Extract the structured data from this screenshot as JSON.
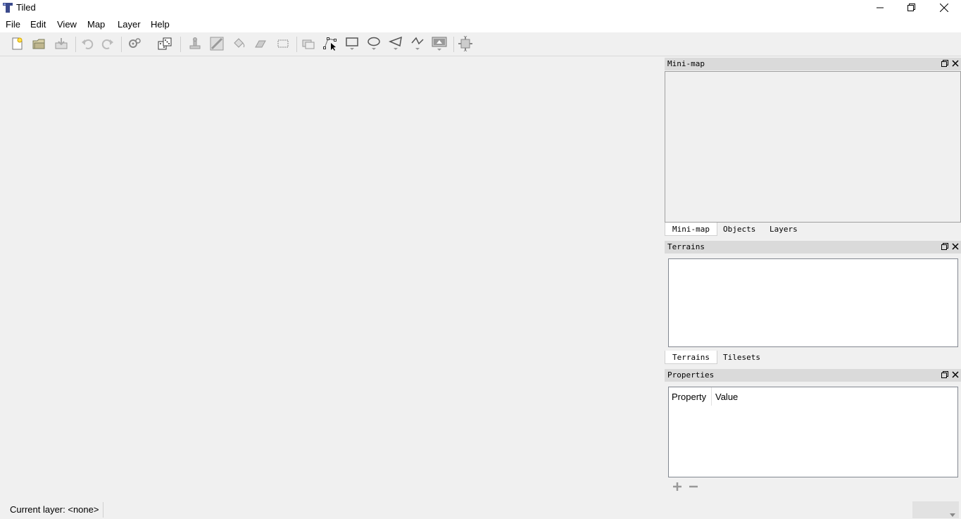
{
  "window": {
    "title": "Tiled"
  },
  "menu": [
    {
      "label": "File"
    },
    {
      "label": "Edit"
    },
    {
      "label": "View"
    },
    {
      "label": "Map"
    },
    {
      "label": "Layer"
    },
    {
      "label": "Help"
    }
  ],
  "minimap_dock": {
    "title": "Mini-map"
  },
  "top_tabs": [
    {
      "label": "Mini-map"
    },
    {
      "label": "Objects"
    },
    {
      "label": "Layers"
    }
  ],
  "terrains_dock": {
    "title": "Terrains"
  },
  "middle_tabs": [
    {
      "label": "Terrains"
    },
    {
      "label": "Tilesets"
    }
  ],
  "properties_dock": {
    "title": "Properties",
    "columns": [
      "Property",
      "Value"
    ]
  },
  "status": {
    "current_layer": "Current layer: <none>"
  },
  "colors": {
    "dock_title_bg": "#dadada",
    "toolbar_bg": "#f0f0f0",
    "panel_bg": "#ffffff"
  },
  "icons": [
    "tiled-app-icon",
    "new-map-icon",
    "open-file-icon",
    "save-icon",
    "undo-icon",
    "redo-icon",
    "commands-icon",
    "random-mode-icon",
    "stamp-brush-icon",
    "terrain-brush-icon",
    "bucket-fill-icon",
    "eraser-icon",
    "rectangular-select-icon",
    "select-objects-icon",
    "edit-polygons-icon",
    "insert-rectangle-icon",
    "insert-ellipse-icon",
    "insert-polygon-icon",
    "insert-polyline-icon",
    "insert-tile-icon",
    "automap-icon"
  ]
}
